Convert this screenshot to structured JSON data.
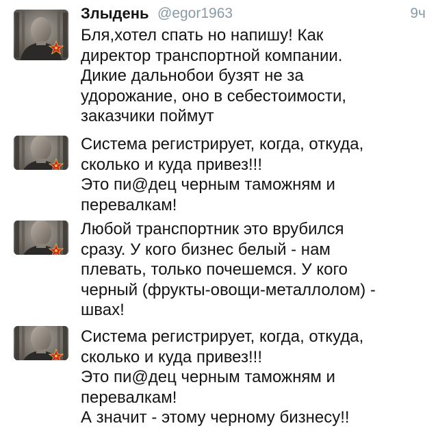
{
  "tweet": {
    "author_name": "Злыдень",
    "author_handle": "@egor1963",
    "timestamp": "9ч"
  },
  "avatar_icon": "profile-photo-with-red-star",
  "colors": {
    "text": "#141414",
    "meta": "#8899a6",
    "star": "#c8281e"
  },
  "thread": [
    {
      "lines": [
        "Бля,хотел спать но напишу! Как",
        "директор транспортной компании.",
        "Дикие дальнобои бузят не за",
        "удорожание, оно в себестоимости,",
        "заказчики поймут"
      ]
    },
    {
      "lines": [
        "Система регистрирует, когда, откуда,",
        "сколько и куда привез!!!",
        "Это пи@дец черным таможням и",
        "перевалкам!"
      ]
    },
    {
      "lines": [
        "Любой транспортник это врубился",
        "сразу. У кого бизнес белый - нам",
        "плевать, только почешемся. У кого",
        "черный (фрукты-овощи-металлолом) -",
        "швах!"
      ]
    },
    {
      "lines": [
        "Система регистрирует, когда, откуда,",
        "сколько и куда привез!!!",
        "Это пи@дец черным таможням и",
        "перевалкам!",
        "А значит - этому черному бизнесу!!"
      ]
    }
  ]
}
